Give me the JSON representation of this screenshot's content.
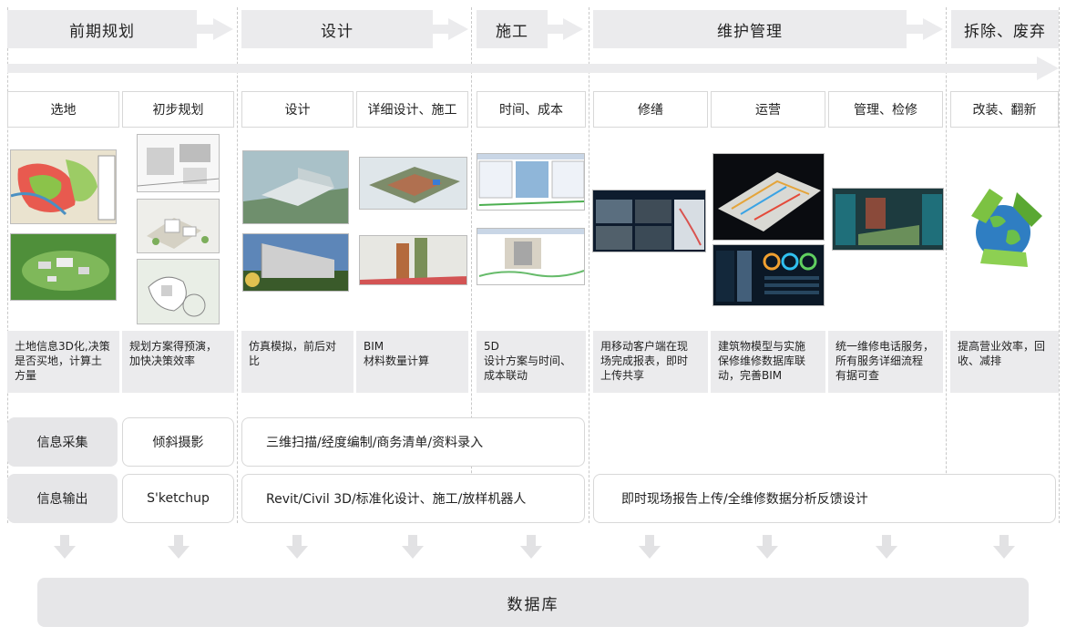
{
  "phases": [
    {
      "label": "前期规划"
    },
    {
      "label": "设计"
    },
    {
      "label": "施工"
    },
    {
      "label": "维护管理"
    },
    {
      "label": "拆除、废弃"
    }
  ],
  "stages": [
    {
      "label": "选地",
      "desc": "土地信息3D化,决策\n是否买地，计算土\n方量"
    },
    {
      "label": "初步规划",
      "desc": "规划方案得预演，\n加快决策效率"
    },
    {
      "label": "设计",
      "desc": "仿真模拟，前后对\n比"
    },
    {
      "label": "详细设计、施工",
      "desc": "BIM\n材料数量计算"
    },
    {
      "label": "时间、成本",
      "desc": "5D\n设计方案与时间、\n成本联动"
    },
    {
      "label": "修缮",
      "desc": "用移动客户端在现\n场完成报表，即时\n上传共享"
    },
    {
      "label": "运营",
      "desc": "建筑物模型与实施\n保修维修数据库联\n动，完善BIM"
    },
    {
      "label": "管理、检修",
      "desc": "统一维修电话服务，\n所有服务详细流程\n有据可查"
    },
    {
      "label": "改装、翻新",
      "desc": "提高营业效率，回\n收、减排"
    }
  ],
  "collect": {
    "label": "信息采集",
    "items": [
      "倾斜摄影",
      "三维扫描/经度编制/商务清单/资料录入"
    ]
  },
  "output": {
    "label": "信息输出",
    "items": [
      "S'ketchup",
      "Revit/Civil 3D/标准化设计、施工/放样机器人",
      "即时现场报告上传/全维修数据分析反馈设计"
    ]
  },
  "database": {
    "label": "数据库"
  },
  "colors": {
    "panel": "#ebebed",
    "border": "#d8d8d8",
    "arrow": "#e2e2e4"
  }
}
